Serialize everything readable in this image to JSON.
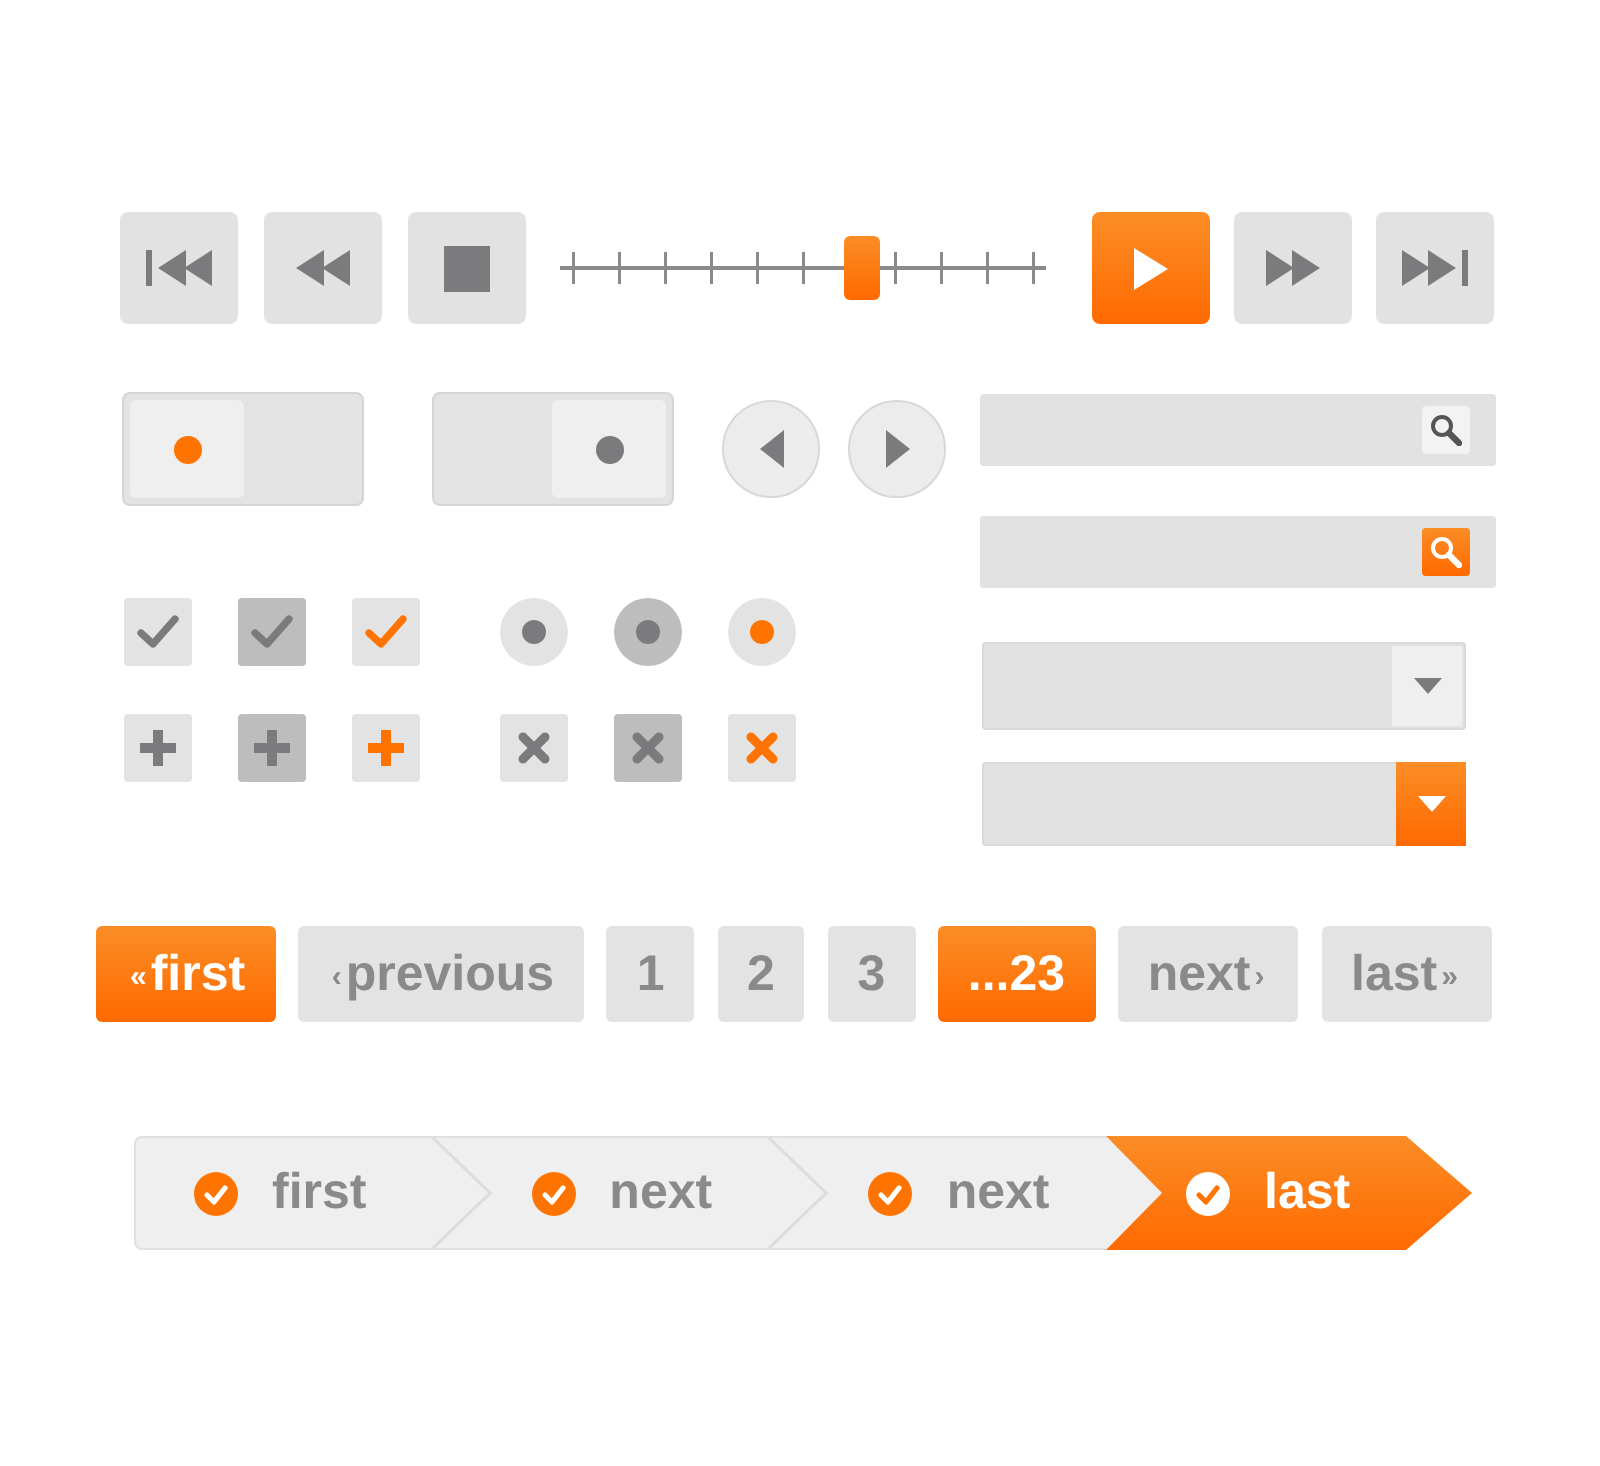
{
  "transport": {
    "buttons_left": [
      {
        "kind": "skip_start",
        "highlighted": false
      },
      {
        "kind": "rewind",
        "highlighted": false
      },
      {
        "kind": "stop",
        "highlighted": false
      }
    ],
    "seek_slider": {
      "level": 0.62
    },
    "buttons_right": [
      {
        "kind": "play",
        "highlighted": true
      },
      {
        "kind": "fast_forward",
        "highlighted": false
      },
      {
        "kind": "skip_end",
        "highlighted": false
      }
    ]
  },
  "toggles": [
    {
      "on": true
    },
    {
      "on": false
    }
  ],
  "search_fields": [
    {
      "highlighted": false
    },
    {
      "highlighted": true
    }
  ],
  "checkboxes": [
    {
      "kind": "normal",
      "checked": true
    },
    {
      "kind": "pressed",
      "checked": true
    },
    {
      "kind": "accent",
      "checked": true
    }
  ],
  "radio_buttons": [
    {
      "kind": "normal",
      "selected": true
    },
    {
      "kind": "pressed",
      "selected": true
    },
    {
      "kind": "accent",
      "selected": true
    }
  ],
  "add_buttons": [
    {
      "kind": "normal"
    },
    {
      "kind": "pressed"
    },
    {
      "kind": "accent"
    }
  ],
  "close_buttons": [
    {
      "kind": "normal"
    },
    {
      "kind": "pressed"
    },
    {
      "kind": "accent"
    }
  ],
  "dropdowns": [
    {
      "highlighted": false
    },
    {
      "highlighted": true
    }
  ],
  "pagination": [
    {
      "label": "first",
      "before": "«",
      "selected": true
    },
    {
      "label": "previous",
      "before": "‹",
      "selected": false
    },
    {
      "label": "1",
      "selected": false
    },
    {
      "label": "2",
      "selected": false
    },
    {
      "label": "3",
      "selected": false
    },
    {
      "label": "...23",
      "selected": true
    },
    {
      "label": "next",
      "after": "›",
      "selected": false
    },
    {
      "label": "last",
      "after": "»",
      "selected": false
    }
  ],
  "steps": [
    {
      "label": "first",
      "selected": false
    },
    {
      "label": "next",
      "selected": false
    },
    {
      "label": "next",
      "selected": false
    },
    {
      "label": "last",
      "selected": true
    }
  ]
}
